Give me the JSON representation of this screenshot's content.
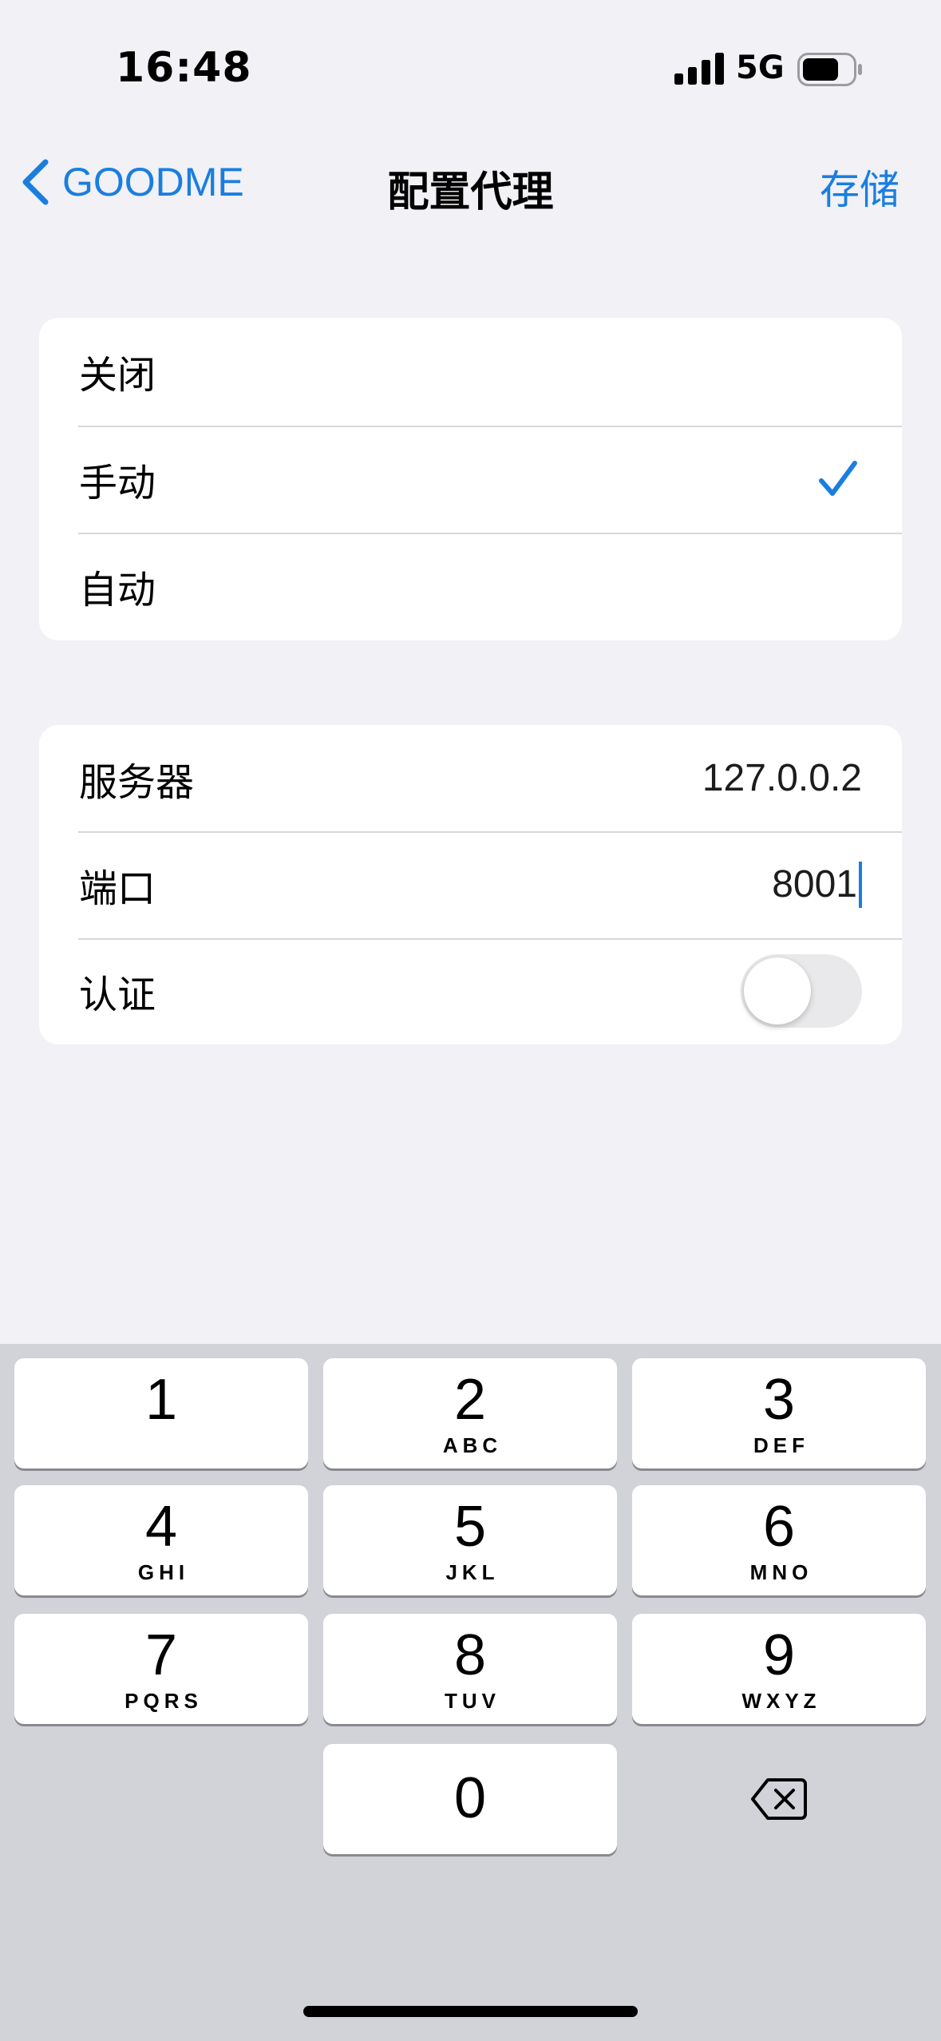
{
  "status_bar": {
    "time": "16:48",
    "network": "5G",
    "icons": [
      "signal-icon",
      "battery-icon"
    ]
  },
  "nav": {
    "back_label": "GOODME",
    "title": "配置代理",
    "save_label": "存储"
  },
  "proxy_mode": {
    "options": [
      {
        "label": "关闭",
        "selected": false
      },
      {
        "label": "手动",
        "selected": true
      },
      {
        "label": "自动",
        "selected": false
      }
    ]
  },
  "proxy_settings": {
    "server": {
      "label": "服务器",
      "value": "127.0.0.2"
    },
    "port": {
      "label": "端口",
      "value": "8001"
    },
    "auth": {
      "label": "认证",
      "enabled": false
    }
  },
  "keyboard": {
    "keys": [
      {
        "digit": "1",
        "letters": ""
      },
      {
        "digit": "2",
        "letters": "ABC"
      },
      {
        "digit": "3",
        "letters": "DEF"
      },
      {
        "digit": "4",
        "letters": "GHI"
      },
      {
        "digit": "5",
        "letters": "JKL"
      },
      {
        "digit": "6",
        "letters": "MNO"
      },
      {
        "digit": "7",
        "letters": "PQRS"
      },
      {
        "digit": "8",
        "letters": "TUV"
      },
      {
        "digit": "9",
        "letters": "WXYZ"
      },
      {
        "digit": "0",
        "letters": ""
      }
    ]
  },
  "colors": {
    "accent": "#1a7ee0",
    "background": "#f1f1f6",
    "keyboard_bg": "#d1d3d9"
  }
}
